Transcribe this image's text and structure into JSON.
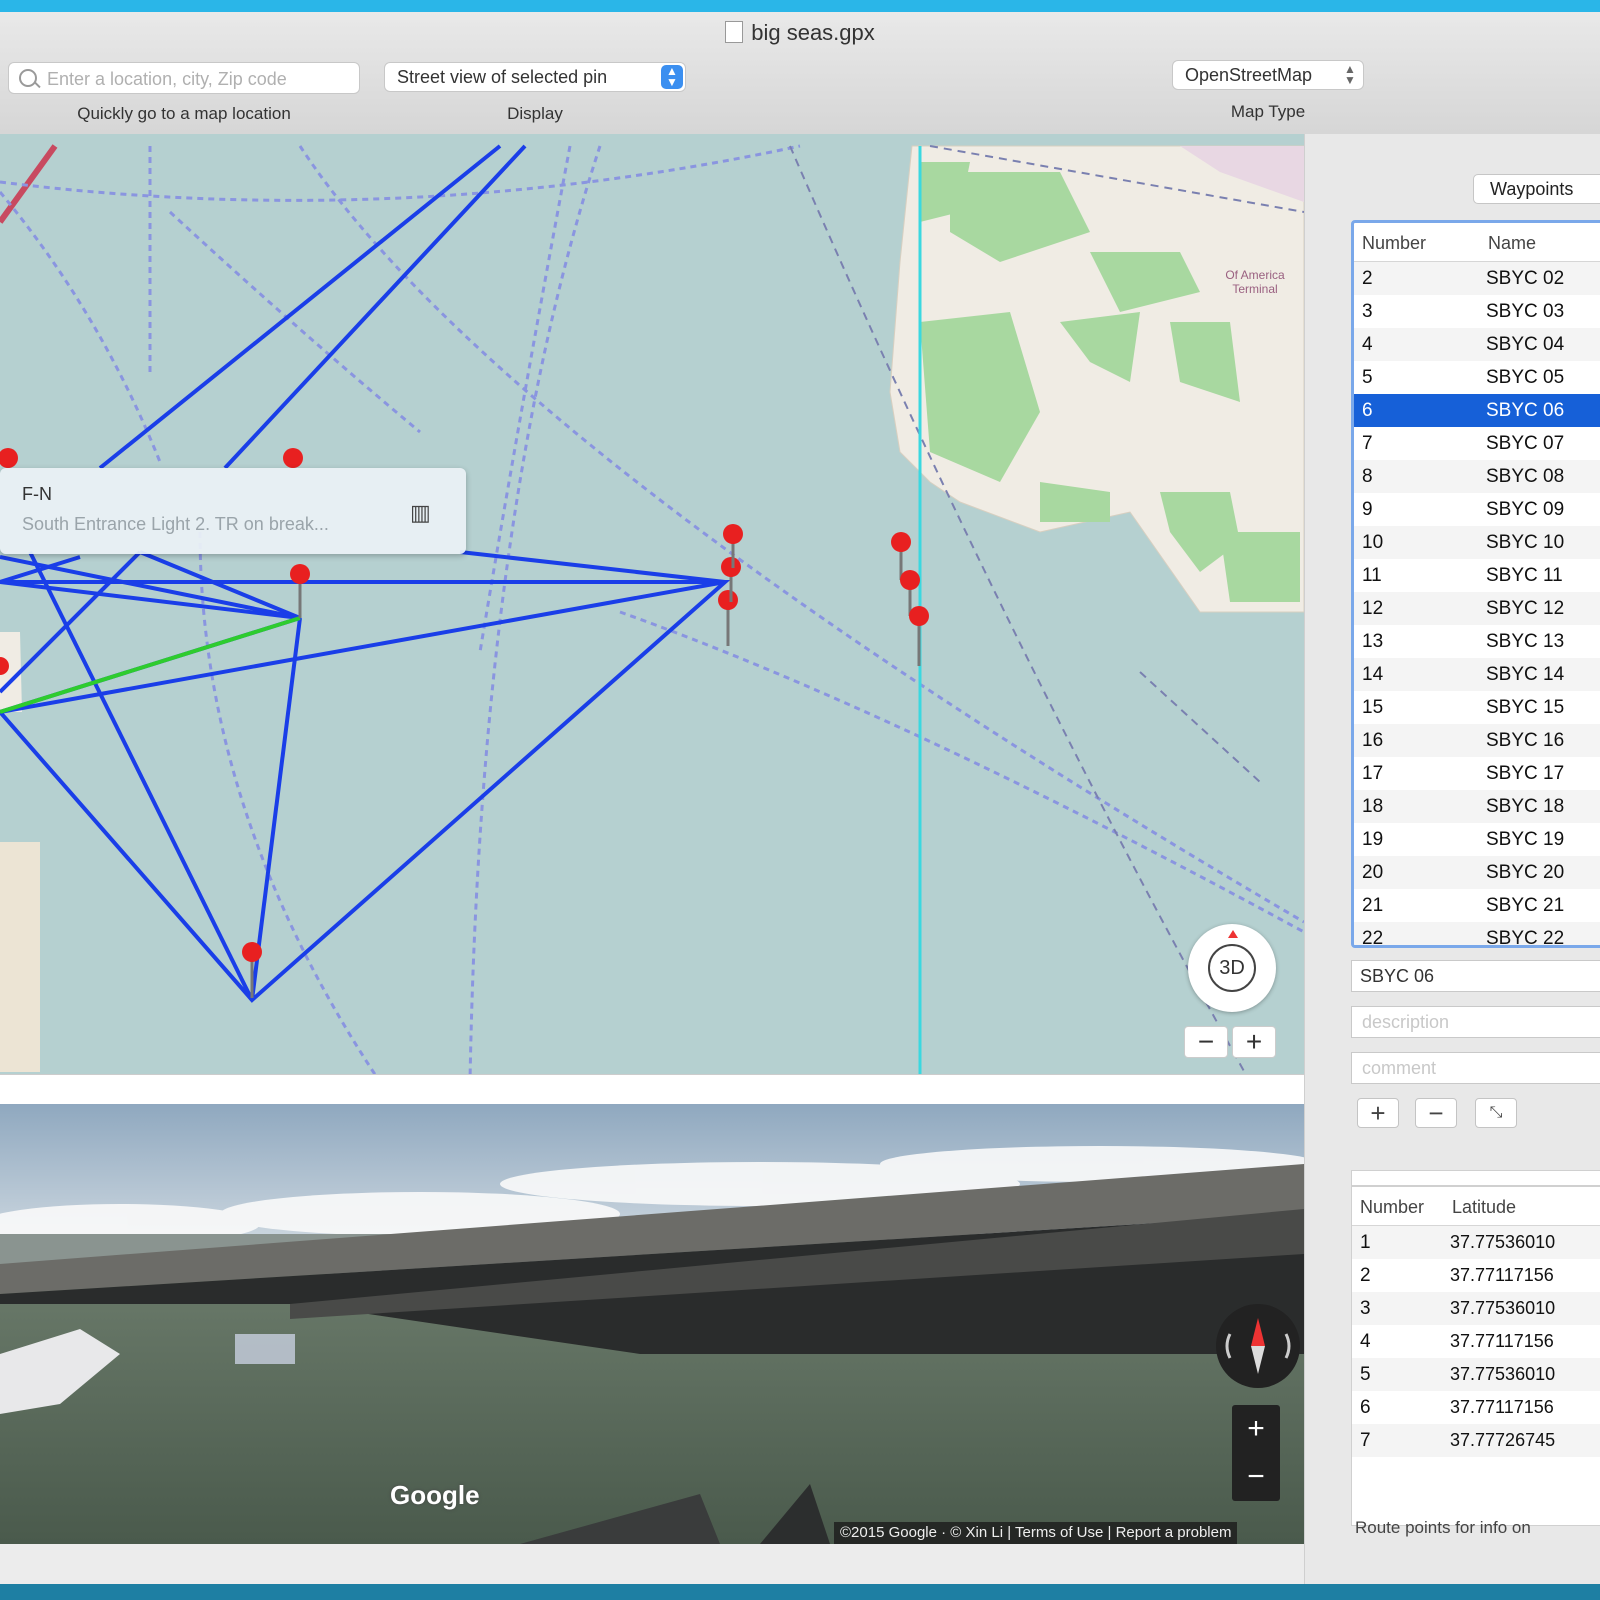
{
  "window": {
    "title": "big seas.gpx"
  },
  "toolbar": {
    "search": {
      "placeholder": "Enter a location, city, Zip code",
      "caption": "Quickly go to a map location"
    },
    "display": {
      "value": "Street view of selected pin",
      "caption": "Display"
    },
    "map_type": {
      "value": "OpenStreetMap",
      "caption": "Map Type"
    }
  },
  "map": {
    "poi_label": "Of America Terminal",
    "callout": {
      "title": "F-N",
      "subtitle": "South Entrance Light 2. TR on break...",
      "icon": "map-icon"
    },
    "compass_label": "3D",
    "zoom_out": "−",
    "zoom_in": "+"
  },
  "street_view": {
    "logo": "Google",
    "attribution": "©2015 Google · © Xin Li | Terms of Use | Report a problem",
    "zoom_in": "+",
    "zoom_out": "−"
  },
  "side_panel": {
    "tab_label": "Waypoints",
    "waypoints": {
      "columns": [
        "Number",
        "Name"
      ],
      "rows": [
        {
          "number": "2",
          "name": "SBYC 02"
        },
        {
          "number": "3",
          "name": "SBYC 03"
        },
        {
          "number": "4",
          "name": "SBYC 04"
        },
        {
          "number": "5",
          "name": "SBYC 05"
        },
        {
          "number": "6",
          "name": "SBYC 06",
          "selected": true
        },
        {
          "number": "7",
          "name": "SBYC 07"
        },
        {
          "number": "8",
          "name": "SBYC 08"
        },
        {
          "number": "9",
          "name": "SBYC 09"
        },
        {
          "number": "10",
          "name": "SBYC 10"
        },
        {
          "number": "11",
          "name": "SBYC 11"
        },
        {
          "number": "12",
          "name": "SBYC 12"
        },
        {
          "number": "13",
          "name": "SBYC 13"
        },
        {
          "number": "14",
          "name": "SBYC 14"
        },
        {
          "number": "15",
          "name": "SBYC 15"
        },
        {
          "number": "16",
          "name": "SBYC 16"
        },
        {
          "number": "17",
          "name": "SBYC 17"
        },
        {
          "number": "18",
          "name": "SBYC 18"
        },
        {
          "number": "19",
          "name": "SBYC 19"
        },
        {
          "number": "20",
          "name": "SBYC 20"
        },
        {
          "number": "21",
          "name": "SBYC 21"
        },
        {
          "number": "22",
          "name": "SBYC 22"
        }
      ]
    },
    "name_field": "SBYC 06",
    "description_placeholder": "description",
    "comment_placeholder": "comment",
    "buttons": {
      "add": "+",
      "remove": "−",
      "edit_icon": "arrows-icon"
    },
    "route_points": {
      "columns": [
        "Number",
        "Latitude"
      ],
      "rows": [
        {
          "number": "1",
          "lat": "37.77536010"
        },
        {
          "number": "2",
          "lat": "37.77117156"
        },
        {
          "number": "3",
          "lat": "37.77536010"
        },
        {
          "number": "4",
          "lat": "37.77117156"
        },
        {
          "number": "5",
          "lat": "37.77536010"
        },
        {
          "number": "6",
          "lat": "37.77117156"
        },
        {
          "number": "7",
          "lat": "37.77726745"
        }
      ]
    },
    "footer": "Route points for info on"
  },
  "colors": {
    "route": "#1a3ee8",
    "route_active": "#2ecc2e",
    "pin": "#e82020",
    "water": "#b5d0d0",
    "selection": "#1660d8"
  }
}
